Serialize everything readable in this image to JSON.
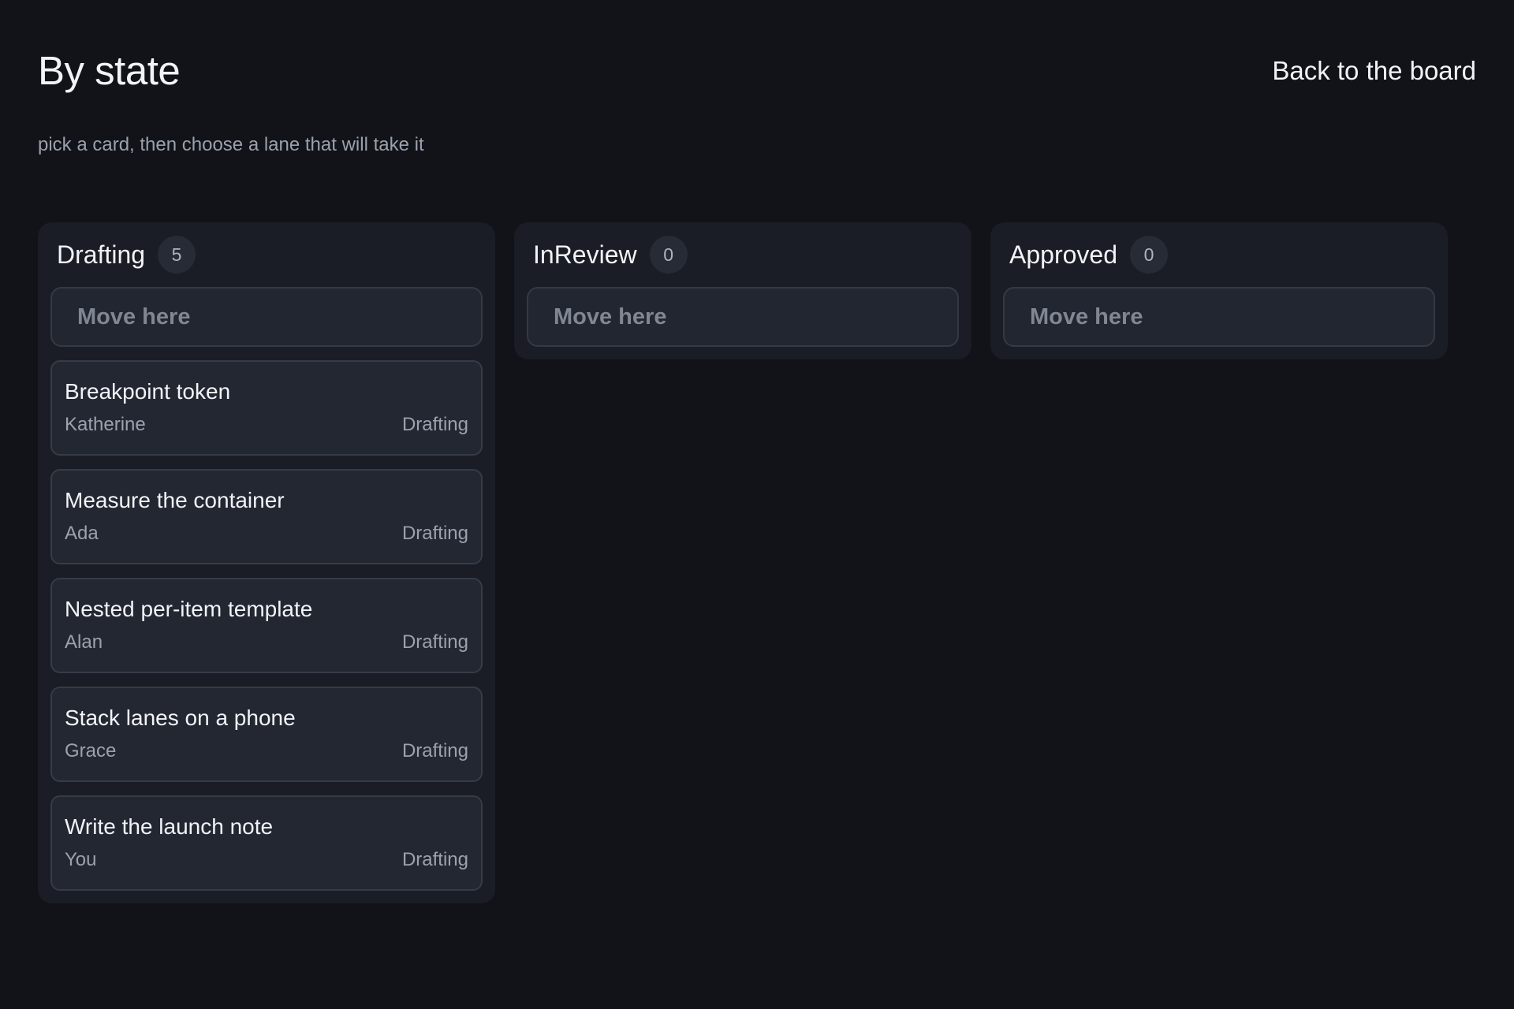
{
  "header": {
    "title": "By state",
    "back_link": "Back to the board",
    "subtitle": "pick a card, then choose a lane that will take it"
  },
  "lanes": [
    {
      "title": "Drafting",
      "count": "5",
      "move_label": "Move here",
      "cards": [
        {
          "title": "Breakpoint token",
          "assignee": "Katherine",
          "state": "Drafting"
        },
        {
          "title": "Measure the container",
          "assignee": "Ada",
          "state": "Drafting"
        },
        {
          "title": "Nested per-item template",
          "assignee": "Alan",
          "state": "Drafting"
        },
        {
          "title": "Stack lanes on a phone",
          "assignee": "Grace",
          "state": "Drafting"
        },
        {
          "title": "Write the launch note",
          "assignee": "You",
          "state": "Drafting"
        }
      ]
    },
    {
      "title": "InReview",
      "count": "0",
      "move_label": "Move here",
      "cards": []
    },
    {
      "title": "Approved",
      "count": "0",
      "move_label": "Move here",
      "cards": []
    }
  ]
}
